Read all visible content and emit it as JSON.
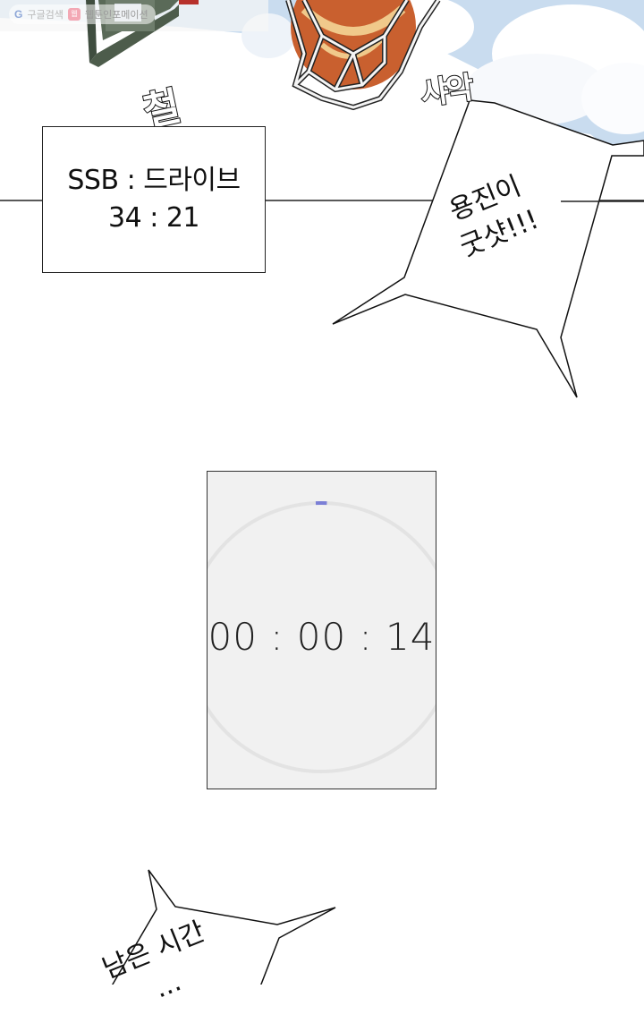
{
  "watermark": {
    "search_brand": "G",
    "search_label": "구글검색",
    "site_badge": "웹",
    "site_name": "웹툰인포메이션"
  },
  "sound_effects": {
    "swish_left": "철",
    "swish_right": "샤악"
  },
  "scoreboard": {
    "teams_line": "SSB : 드라이브",
    "score_line": "34 : 21",
    "team_a": "SSB",
    "team_b": "드라이브",
    "score_a": 34,
    "score_b": 21
  },
  "speech_bubbles": [
    {
      "lines": [
        "용진이",
        "굿샷!!!"
      ]
    },
    {
      "lines": [
        "남은 시간",
        "..."
      ]
    }
  ],
  "timer": {
    "display": "00 : 00 : 14",
    "hours": "00",
    "minutes": "00",
    "seconds": "14",
    "progress_fraction": 0.01,
    "accent_color": "#7b7fd6",
    "track_color": "#e3e3e3"
  },
  "colors": {
    "sky": "#bcd6ee",
    "cloud": "#ffffff",
    "backboard": "#4c5a4a",
    "ball": "#c4562a",
    "net": "#f2f2f2"
  }
}
